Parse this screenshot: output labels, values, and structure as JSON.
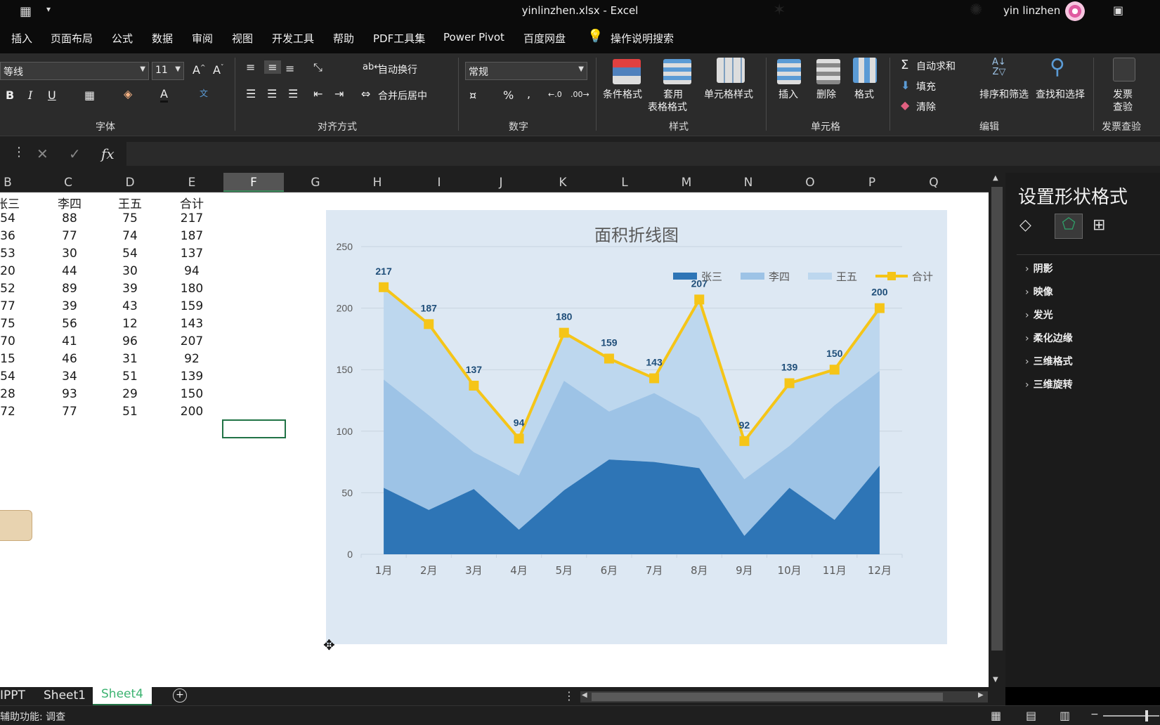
{
  "window": {
    "title": "yinlinzhen.xlsx  -  Excel",
    "user": "yin linzhen"
  },
  "menu": [
    "插入",
    "页面布局",
    "公式",
    "数据",
    "审阅",
    "视图",
    "开发工具",
    "帮助",
    "PDF工具集",
    "Power Pivot",
    "百度网盘",
    "操作说明搜索"
  ],
  "ribbon": {
    "font_name": "等线",
    "font_size": "11",
    "groups": {
      "font": "字体",
      "align": "对齐方式",
      "number": "数字",
      "style": "样式",
      "cells": "单元格",
      "edit": "编辑",
      "invoice": "发票查验"
    },
    "wrap_text": "自动换行",
    "merge_center": "合并后居中",
    "number_format": "常规",
    "cond_format": "条件格式",
    "table_format_1": "套用",
    "table_format_2": "表格格式",
    "cell_style": "单元格样式",
    "insert": "插入",
    "delete": "删除",
    "format": "格式",
    "autosum": "自动求和",
    "fill": "填充",
    "clear": "清除",
    "sort_filter": "排序和筛选",
    "find_select": "查找和选择",
    "invoice_1": "发票",
    "invoice_2": "查验",
    "percent": "%",
    "comma": ","
  },
  "formula_bar": {
    "fx": "fx"
  },
  "columns": [
    "B",
    "C",
    "D",
    "E",
    "F",
    "G",
    "H",
    "I",
    "J",
    "K",
    "L",
    "M",
    "N",
    "O",
    "P",
    "Q"
  ],
  "selected_column": "F",
  "table": {
    "headers": [
      "张三",
      "李四",
      "王五",
      "合计"
    ],
    "rows": [
      [
        "54",
        "88",
        "75",
        "217"
      ],
      [
        "36",
        "77",
        "74",
        "187"
      ],
      [
        "53",
        "30",
        "54",
        "137"
      ],
      [
        "20",
        "44",
        "30",
        "94"
      ],
      [
        "52",
        "89",
        "39",
        "180"
      ],
      [
        "77",
        "39",
        "43",
        "159"
      ],
      [
        "75",
        "56",
        "12",
        "143"
      ],
      [
        "70",
        "41",
        "96",
        "207"
      ],
      [
        "15",
        "46",
        "31",
        "92"
      ],
      [
        "54",
        "34",
        "51",
        "139"
      ],
      [
        "28",
        "93",
        "29",
        "150"
      ],
      [
        "72",
        "77",
        "51",
        "200"
      ]
    ]
  },
  "chart_data": {
    "type": "area",
    "title": "面积折线图",
    "categories": [
      "1月",
      "2月",
      "3月",
      "4月",
      "5月",
      "6月",
      "7月",
      "8月",
      "9月",
      "10月",
      "11月",
      "12月"
    ],
    "series": [
      {
        "name": "张三",
        "type": "area",
        "values": [
          54,
          36,
          53,
          20,
          52,
          77,
          75,
          70,
          15,
          54,
          28,
          72
        ],
        "color": "#2e75b6"
      },
      {
        "name": "李四",
        "type": "area",
        "values": [
          88,
          77,
          30,
          44,
          89,
          39,
          56,
          41,
          46,
          34,
          93,
          77
        ],
        "color": "#9dc3e6"
      },
      {
        "name": "王五",
        "type": "area",
        "values": [
          75,
          74,
          54,
          30,
          39,
          43,
          12,
          96,
          31,
          51,
          29,
          51
        ],
        "color": "#bdd7ee"
      },
      {
        "name": "合计",
        "type": "line",
        "values": [
          217,
          187,
          137,
          94,
          180,
          159,
          143,
          207,
          92,
          139,
          150,
          200
        ],
        "color": "#f5c518"
      }
    ],
    "stacked": true,
    "ylim": [
      0,
      250
    ],
    "yticks": [
      0,
      50,
      100,
      150,
      200,
      250
    ],
    "grid": true,
    "legend": "top-right",
    "data_labels": "line-above"
  },
  "panel": {
    "title": "设置形状格式",
    "items": [
      "阴影",
      "映像",
      "发光",
      "柔化边缘",
      "三维格式",
      "三维旋转"
    ]
  },
  "sheets": [
    "IPPT",
    "Sheet1",
    "Sheet4"
  ],
  "active_sheet": "Sheet4",
  "status": "辅助功能: 调查"
}
